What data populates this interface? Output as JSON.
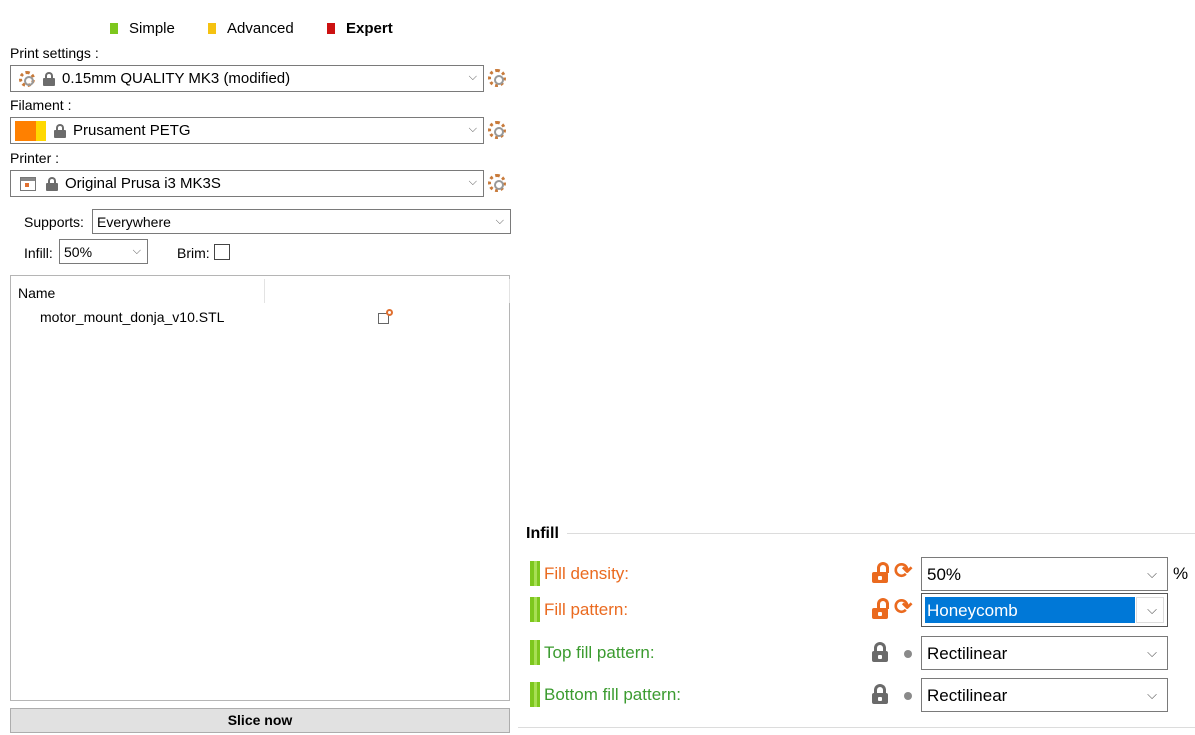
{
  "modes": {
    "simple": {
      "label": "Simple",
      "color": "#7dc71e"
    },
    "advanced": {
      "label": "Advanced",
      "color": "#f5c211"
    },
    "expert": {
      "label": "Expert",
      "color": "#cc1111"
    }
  },
  "print_settings": {
    "label": "Print settings :",
    "value": "0.15mm QUALITY MK3 (modified)"
  },
  "filament": {
    "label": "Filament :",
    "value": "Prusament PETG",
    "swatch_colors": [
      "#ff8000",
      "#ffd800"
    ]
  },
  "printer": {
    "label": "Printer :",
    "value": "Original Prusa i3 MK3S"
  },
  "supports": {
    "label": "Supports:",
    "value": "Everywhere"
  },
  "infill_quick": {
    "label": "Infill:",
    "value": "50%"
  },
  "brim": {
    "label": "Brim:",
    "checked": false
  },
  "object_list": {
    "column_name": "Name",
    "items": [
      {
        "name": "motor_mount_donja_v10.STL"
      }
    ]
  },
  "slice_button": "Slice now",
  "infill_section": {
    "title": "Infill",
    "options": [
      {
        "label": "Fill density:",
        "value": "50%",
        "unit": "%",
        "state": "modified"
      },
      {
        "label": "Fill pattern:",
        "value": "Honeycomb",
        "state": "modified",
        "selected": true
      },
      {
        "label": "Top fill pattern:",
        "value": "Rectilinear",
        "state": "default"
      },
      {
        "label": "Bottom fill pattern:",
        "value": "Rectilinear",
        "state": "default"
      }
    ]
  },
  "colors": {
    "modified": "#ea6a1f",
    "default": "#3b9b2f",
    "selection": "#0078d7"
  }
}
